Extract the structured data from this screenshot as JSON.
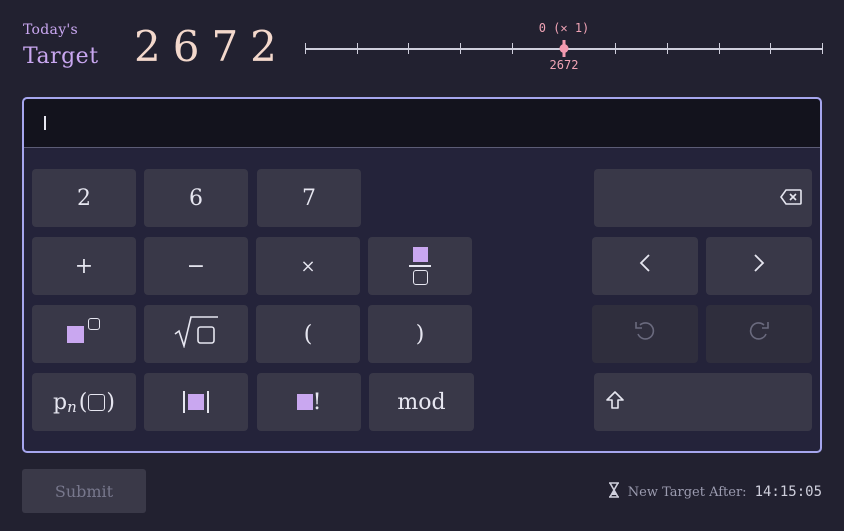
{
  "header": {
    "target_small": "Today's",
    "target_big": "Target",
    "target_number": "2672"
  },
  "slider": {
    "top_label": "0 (✕ 1)",
    "bottom_label": "2672",
    "ticks": 11,
    "position_fraction": 0.5
  },
  "keypad": {
    "digits": [
      "2",
      "6",
      "7"
    ],
    "operators": {
      "plus": "+",
      "minus": "−",
      "times": "×"
    },
    "parens": {
      "open": "(",
      "close": ")"
    },
    "mod_label": "mod",
    "prime_label": "p",
    "prime_subscript": "n",
    "factorial_suffix": "!"
  },
  "submit_label": "Submit",
  "timer": {
    "label": "New Target After:",
    "value": "14:15:05"
  },
  "colors": {
    "background": "#222130",
    "accent_purple": "#c9a7f0",
    "accent_pink": "#f39ab0",
    "panel_border": "#a6a6ee"
  }
}
